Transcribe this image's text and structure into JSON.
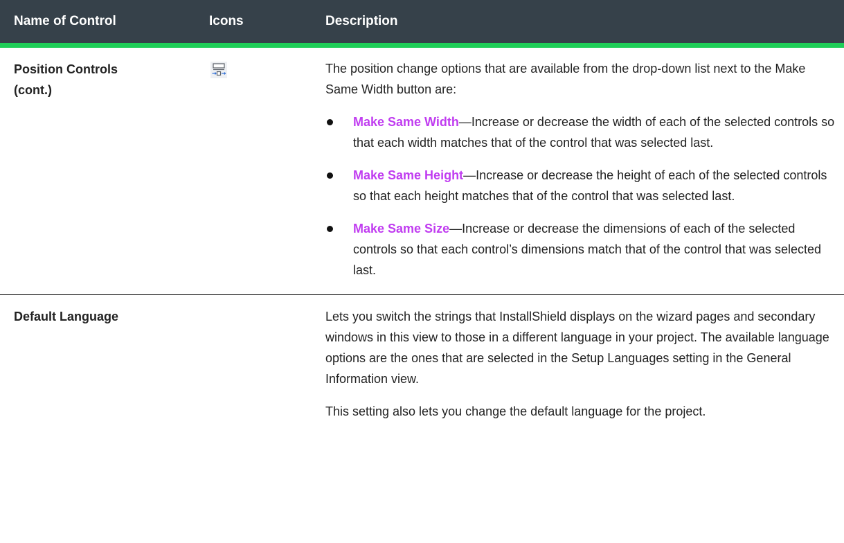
{
  "table": {
    "headers": {
      "name": "Name of Control",
      "icons": "Icons",
      "description": "Description"
    },
    "rows": [
      {
        "name_line1": "Position Controls",
        "name_line2": "(cont.)",
        "icon": "make-same-width-icon",
        "intro": "The position change options that are available from the drop-down list next to the Make Same Width button are:",
        "bullets": [
          {
            "term": "Make Same Width",
            "text": "—Increase or decrease the width of each of the selected controls so that each width matches that of the control that was selected last."
          },
          {
            "term": "Make Same Height",
            "text": "—Increase or decrease the height of each of the selected controls so that each height matches that of the control that was selected last."
          },
          {
            "term": "Make Same Size",
            "text": "—Increase or decrease the dimensions of each of the selected controls so that each control’s dimensions match that of the control that was selected last."
          }
        ]
      },
      {
        "name": "Default Language",
        "paragraphs": [
          "Lets you switch the strings that InstallShield displays on the wizard pages and secondary windows in this view to those in a different language in your project. The available language options are the ones that are selected in the Setup Languages setting in the General Information view.",
          "This setting also lets you change the default language for the project."
        ]
      }
    ]
  },
  "colors": {
    "header_bg": "#36414a",
    "header_rule": "#1fce58",
    "term": "#c03cf0"
  }
}
